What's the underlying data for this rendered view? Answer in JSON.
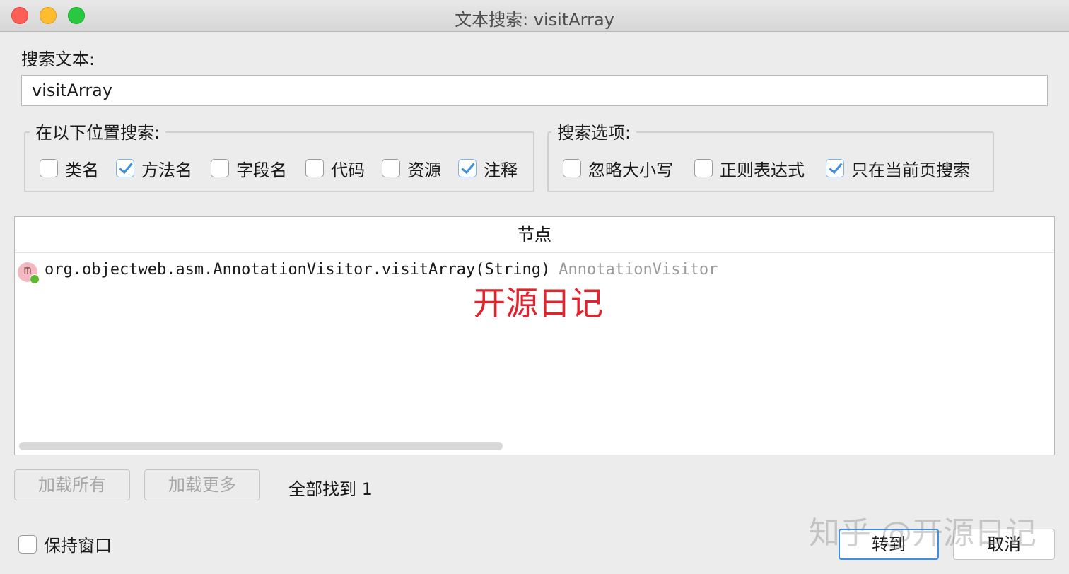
{
  "window": {
    "title": "文本搜索: visitArray"
  },
  "search": {
    "label": "搜索文本:",
    "value": "visitArray"
  },
  "location_group": {
    "legend": "在以下位置搜索:",
    "options": [
      {
        "label": "类名",
        "checked": false
      },
      {
        "label": "方法名",
        "checked": true
      },
      {
        "label": "字段名",
        "checked": false
      },
      {
        "label": "代码",
        "checked": false
      },
      {
        "label": "资源",
        "checked": false
      },
      {
        "label": "注释",
        "checked": true
      }
    ]
  },
  "options_group": {
    "legend": "搜索选项:",
    "options": [
      {
        "label": "忽略大小写",
        "checked": false
      },
      {
        "label": "正则表达式",
        "checked": false
      },
      {
        "label": "只在当前页搜索",
        "checked": true
      }
    ]
  },
  "results": {
    "column_header": "节点",
    "rows": [
      {
        "icon_letter": "m",
        "icon": "method-icon",
        "text": "org.objectweb.asm.AnnotationVisitor.visitArray(String)",
        "type": "AnnotationVisitor"
      }
    ]
  },
  "watermark_red": "开源日记",
  "buttons": {
    "load_all": "加载所有",
    "load_more": "加载更多",
    "goto": "转到",
    "cancel": "取消"
  },
  "status": {
    "found": "全部找到  1"
  },
  "keep_window": {
    "label": "保持窗口",
    "checked": false
  },
  "watermark_zhihu": "知乎 @开源日记",
  "colors": {
    "accent": "#3d8fe0",
    "watermark": "#e0232c",
    "method_icon_bg": "#f4b8c0",
    "status_dot": "#5fb832"
  }
}
